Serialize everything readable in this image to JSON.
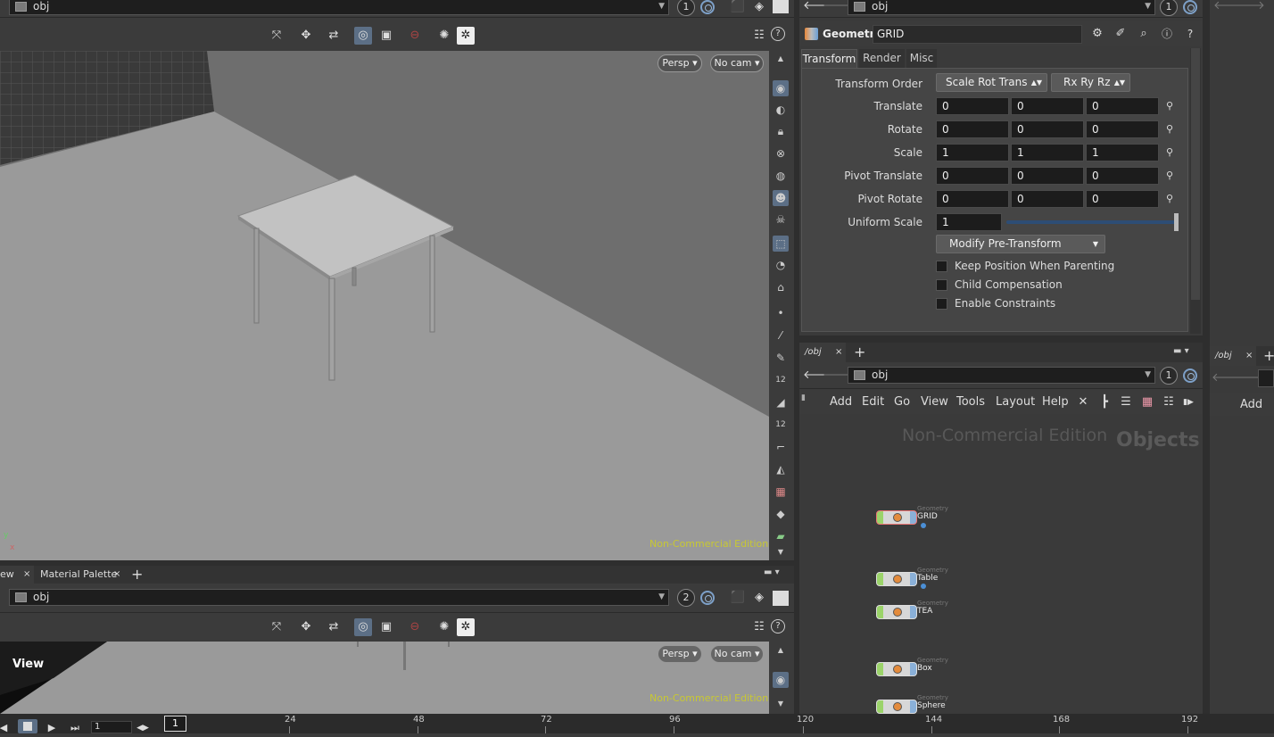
{
  "viewport_top": {
    "path": "obj",
    "pane_number": "1",
    "persp": "Persp",
    "camera": "No cam",
    "watermark": "Non-Commercial Edition",
    "axis_y": "y",
    "axis_x": "x"
  },
  "viewport_bottom": {
    "tabs": [
      {
        "label": "ew"
      },
      {
        "label": "Material Palette"
      }
    ],
    "path": "obj",
    "pane_number": "2",
    "persp": "Persp",
    "camera": "No cam",
    "watermark": "Non-Commercial Edition",
    "view_label": "View"
  },
  "params": {
    "path": "obj",
    "pane_number": "1",
    "node_type": "Geometry",
    "node_name": "GRID",
    "tabs": [
      {
        "label": "Transform"
      },
      {
        "label": "Render"
      },
      {
        "label": "Misc"
      }
    ],
    "transform_order_label": "Transform Order",
    "transform_order_value": "Scale Rot Trans",
    "rotate_order_value": "Rx Ry Rz",
    "rows": [
      {
        "label": "Translate",
        "x": "0",
        "y": "0",
        "z": "0"
      },
      {
        "label": "Rotate",
        "x": "0",
        "y": "0",
        "z": "0"
      },
      {
        "label": "Scale",
        "x": "1",
        "y": "1",
        "z": "1"
      },
      {
        "label": "Pivot Translate",
        "x": "0",
        "y": "0",
        "z": "0"
      },
      {
        "label": "Pivot Rotate",
        "x": "0",
        "y": "0",
        "z": "0"
      }
    ],
    "uniform_scale_label": "Uniform Scale",
    "uniform_scale_value": "1",
    "modify_label": "Modify Pre-Transform",
    "checkboxes": [
      {
        "label": "Keep Position When Parenting"
      },
      {
        "label": "Child Compensation"
      },
      {
        "label": "Enable Constraints"
      }
    ]
  },
  "network": {
    "tab_label": "/obj",
    "path": "obj",
    "pane_number": "1",
    "menu": [
      "Add",
      "Edit",
      "Go",
      "View",
      "Tools",
      "Layout",
      "Help"
    ],
    "watermark": "Non-Commercial Edition",
    "context_label": "Objects",
    "nodes": [
      {
        "type": "Geometry",
        "name": "GRID"
      },
      {
        "type": "Geometry",
        "name": "Table"
      },
      {
        "type": "Geometry",
        "name": "TEA"
      },
      {
        "type": "Geometry",
        "name": "Box"
      },
      {
        "type": "Geometry",
        "name": "Sphere"
      }
    ]
  },
  "right_pane": {
    "tab_label": "/obj",
    "menu_add": "Add"
  },
  "timeline": {
    "frame": "1",
    "frame_field": "1",
    "ticks": [
      "24",
      "48",
      "72",
      "96",
      "120",
      "144",
      "168",
      "192"
    ]
  }
}
